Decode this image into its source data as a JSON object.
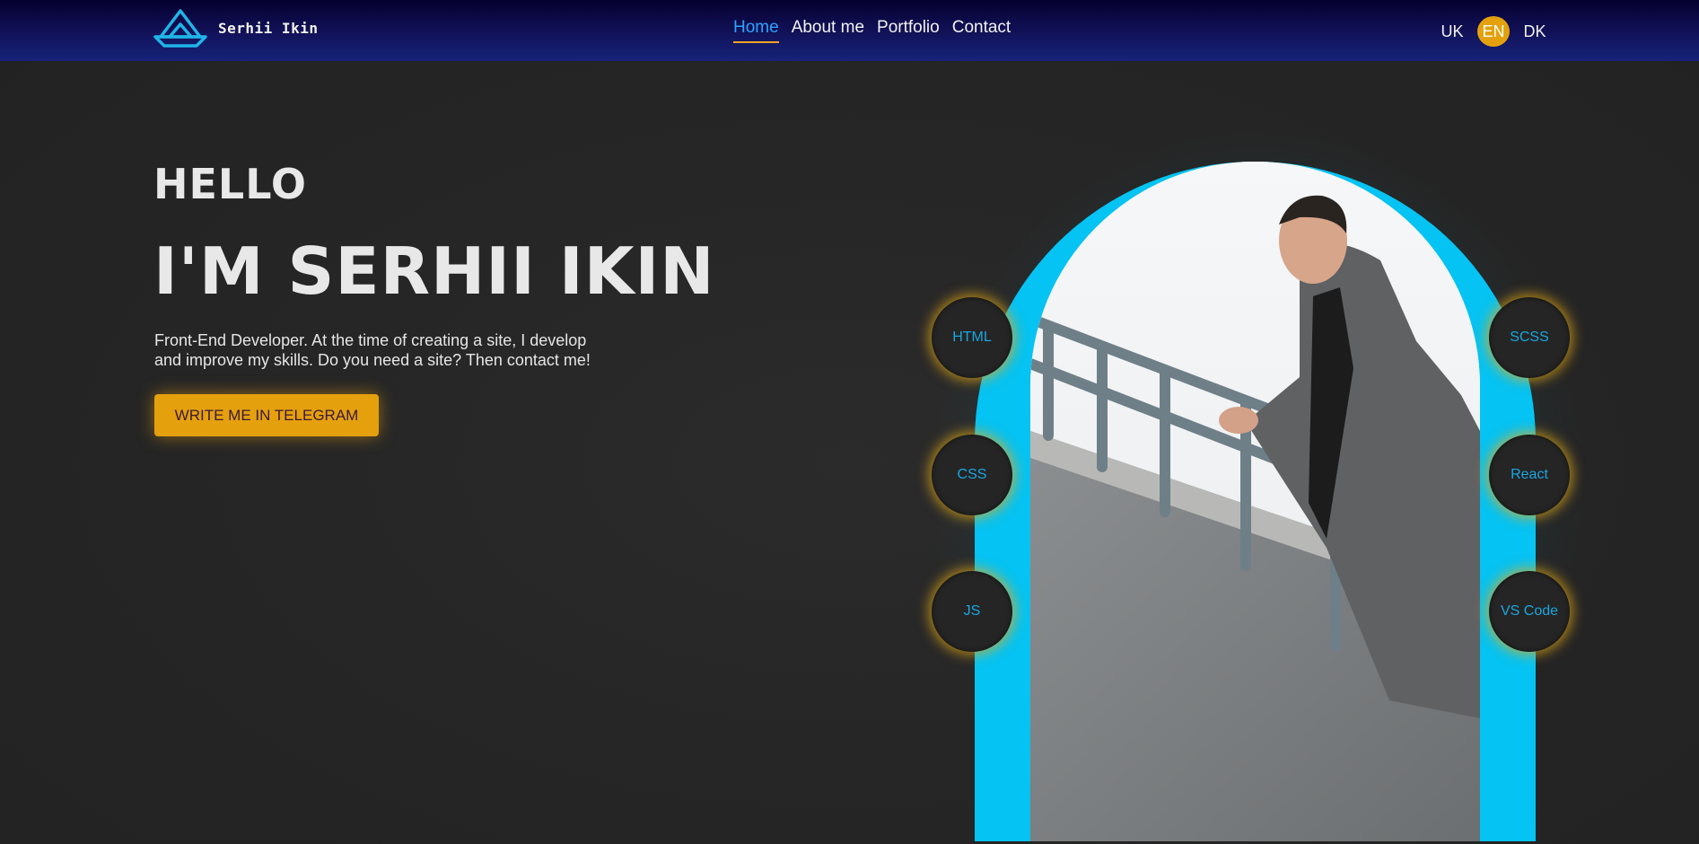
{
  "header": {
    "logo_text": "Serhii Ikin",
    "nav": [
      {
        "label": "Home",
        "active": true
      },
      {
        "label": "About me"
      },
      {
        "label": "Portfolio"
      },
      {
        "label": "Contact"
      }
    ],
    "languages": [
      {
        "label": "UK"
      },
      {
        "label": "EN",
        "active": true
      },
      {
        "label": "DK"
      }
    ]
  },
  "hero": {
    "greeting": "HELLO",
    "name": "I'M SERHII IKIN",
    "description_line1": "Front-End Developer. At the time of creating a site, I develop",
    "description_line2": "and improve my skills. Do you need a site? Then contact me!",
    "cta_label": "WRITE ME IN TELEGRAM"
  },
  "skills": {
    "left": [
      "HTML",
      "CSS",
      "JS"
    ],
    "right": [
      "SCSS",
      "React",
      "VS Code"
    ]
  },
  "colors": {
    "accent_orange": "#e5a00d",
    "accent_cyan": "#05c3f2",
    "active_link": "#2ea3ff",
    "header_top": "#050030",
    "header_bottom": "#15237a"
  },
  "icons": {
    "logo": "paper-boat-icon"
  }
}
